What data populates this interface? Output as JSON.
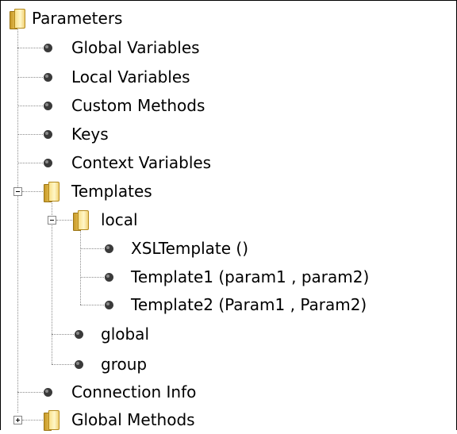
{
  "tree": {
    "root_label": "Parameters",
    "items": [
      {
        "label": "Global Variables"
      },
      {
        "label": "Local Variables"
      },
      {
        "label": "Custom Methods"
      },
      {
        "label": "Keys"
      },
      {
        "label": "Context Variables"
      }
    ],
    "templates": {
      "label": "Templates",
      "local": {
        "label": "local",
        "children": [
          {
            "label": "XSLTemplate ()"
          },
          {
            "label": "Template1 (param1 , param2)"
          },
          {
            "label": "Template2 (Param1 , Param2)"
          }
        ]
      },
      "global_label": "global",
      "group_label": "group"
    },
    "connection_info_label": "Connection Info",
    "global_methods_label": "Global Methods"
  },
  "colors": {
    "folder": "#f1d173",
    "bullet": "#3a3a3a",
    "connector": "#8c8c8c"
  },
  "icons": {
    "folder": "folder-icon",
    "bullet": "bullet-icon",
    "expand": "expand-plus-icon",
    "collapse": "collapse-minus-icon"
  }
}
